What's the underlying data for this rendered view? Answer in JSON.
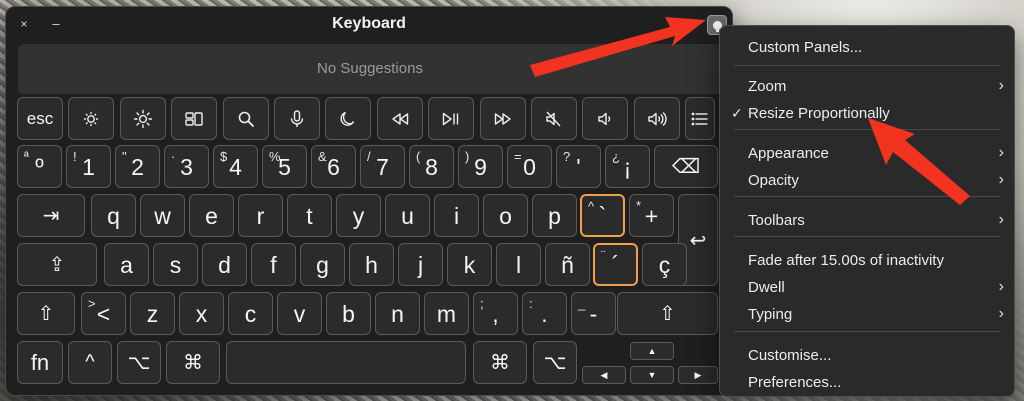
{
  "window": {
    "title": "Keyboard",
    "close_label": "×",
    "minimize_label": "–"
  },
  "suggestion_bar": {
    "text": "No Suggestions"
  },
  "rows": {
    "r1": [
      {
        "type": "word",
        "label": "esc",
        "name": "key-esc"
      },
      {
        "type": "icon",
        "icon": "brightness-down-icon",
        "name": "key-brightness-down"
      },
      {
        "type": "icon",
        "icon": "brightness-up-icon",
        "name": "key-brightness-up"
      },
      {
        "type": "icon",
        "icon": "mission-control-icon",
        "name": "key-mission-control"
      },
      {
        "type": "icon",
        "icon": "search-icon",
        "name": "key-search"
      },
      {
        "type": "icon",
        "icon": "microphone-icon",
        "name": "key-dictation"
      },
      {
        "type": "icon",
        "icon": "moon-icon",
        "name": "key-do-not-disturb"
      },
      {
        "type": "icon",
        "icon": "rewind-icon",
        "name": "key-rewind"
      },
      {
        "type": "icon",
        "icon": "play-pause-icon",
        "name": "key-play-pause"
      },
      {
        "type": "icon",
        "icon": "fast-forward-icon",
        "name": "key-fast-forward"
      },
      {
        "type": "icon",
        "icon": "mute-icon",
        "name": "key-mute"
      },
      {
        "type": "icon",
        "icon": "volume-down-icon",
        "name": "key-volume-down"
      },
      {
        "type": "icon",
        "icon": "volume-up-icon",
        "name": "key-volume-up"
      },
      {
        "type": "icon",
        "icon": "list-icon",
        "name": "key-list"
      }
    ],
    "r2": [
      {
        "shift": "ª",
        "main": "º"
      },
      {
        "shift": "!",
        "main": "1"
      },
      {
        "shift": "\"",
        "main": "2"
      },
      {
        "shift": "·",
        "main": "3"
      },
      {
        "shift": "$",
        "main": "4"
      },
      {
        "shift": "%",
        "main": "5"
      },
      {
        "shift": "&",
        "main": "6"
      },
      {
        "shift": "/",
        "main": "7"
      },
      {
        "shift": "(",
        "main": "8"
      },
      {
        "shift": ")",
        "main": "9"
      },
      {
        "shift": "=",
        "main": "0"
      },
      {
        "shift": "?",
        "main": "'"
      },
      {
        "shift": "¿",
        "main": "¡"
      }
    ],
    "r3_letters": [
      "q",
      "w",
      "e",
      "r",
      "t",
      "y",
      "u",
      "i",
      "o",
      "p"
    ],
    "r3_extra": [
      {
        "shift": "^",
        "main": "`",
        "hl": true
      },
      {
        "shift": "*",
        "main": "+"
      }
    ],
    "r4_letters": [
      "a",
      "s",
      "d",
      "f",
      "g",
      "h",
      "j",
      "k",
      "l",
      "ñ"
    ],
    "r4_extra": [
      {
        "shift": "¨",
        "main": "´",
        "hl": true
      },
      {
        "shift": "",
        "main": "ç"
      }
    ],
    "r5": [
      {
        "shift": ">",
        "main": "<"
      },
      {
        "shift": "",
        "main": "z"
      },
      {
        "shift": "",
        "main": "x"
      },
      {
        "shift": "",
        "main": "c"
      },
      {
        "shift": "",
        "main": "v"
      },
      {
        "shift": "",
        "main": "b"
      },
      {
        "shift": "",
        "main": "n"
      },
      {
        "shift": "",
        "main": "m"
      },
      {
        "shift": ";",
        "main": ","
      },
      {
        "shift": ":",
        "main": "."
      },
      {
        "shift": "_",
        "main": "-"
      }
    ],
    "r6": {
      "fn": "fn",
      "control": "^",
      "option": "⌥",
      "command": "⌘"
    }
  },
  "menu": {
    "items": [
      {
        "label": "Custom Panels...",
        "arrow": false,
        "check": false
      },
      {
        "label": "Zoom",
        "arrow": true,
        "check": false
      },
      {
        "label": "Resize Proportionally",
        "arrow": false,
        "check": true
      },
      {
        "label": "Appearance",
        "arrow": true,
        "check": false
      },
      {
        "label": "Opacity",
        "arrow": true,
        "check": false
      },
      {
        "label": "Toolbars",
        "arrow": true,
        "check": false
      },
      {
        "label": "Fade after 15.00s of inactivity",
        "arrow": false,
        "check": false
      },
      {
        "label": "Dwell",
        "arrow": true,
        "check": false
      },
      {
        "label": "Typing",
        "arrow": true,
        "check": false
      },
      {
        "label": "Customise...",
        "arrow": false,
        "check": false
      },
      {
        "label": "Preferences...",
        "arrow": false,
        "check": false
      }
    ],
    "check_glyph": "✓",
    "arrow_glyph": "›"
  },
  "glyphs": {
    "delete": "⌫",
    "tab": "⇥",
    "return": "↩",
    "caps": "⇪",
    "shift": "⇧",
    "up": "▲",
    "down": "▼",
    "left": "◀",
    "right": "▶"
  },
  "colors": {
    "highlight": "#f0a04a",
    "annotation_arrow": "#f2331f"
  }
}
